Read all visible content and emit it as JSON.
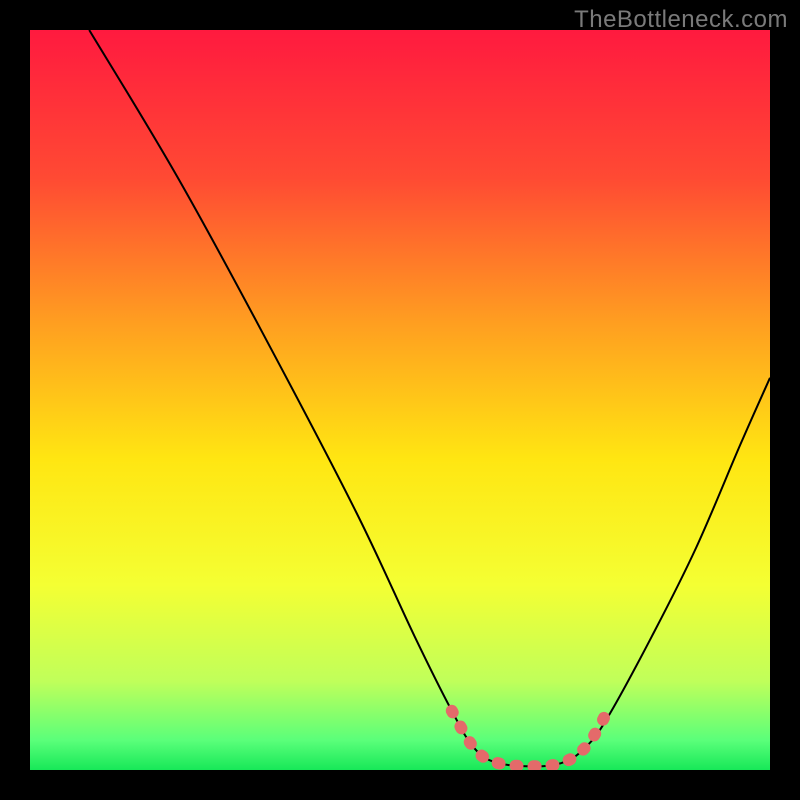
{
  "watermark": "TheBottleneck.com",
  "chart_data": {
    "type": "line",
    "title": "",
    "xlabel": "",
    "ylabel": "",
    "xlim": [
      0,
      100
    ],
    "ylim": [
      0,
      100
    ],
    "gradient_stops": [
      {
        "offset": 0.0,
        "color": "#ff1a3f"
      },
      {
        "offset": 0.2,
        "color": "#ff4a33"
      },
      {
        "offset": 0.4,
        "color": "#ffa020"
      },
      {
        "offset": 0.58,
        "color": "#ffe612"
      },
      {
        "offset": 0.75,
        "color": "#f4ff33"
      },
      {
        "offset": 0.88,
        "color": "#c0ff5a"
      },
      {
        "offset": 0.96,
        "color": "#5aff7a"
      },
      {
        "offset": 1.0,
        "color": "#17e858"
      }
    ],
    "series": [
      {
        "name": "bottleneck-curve",
        "stroke": "#000000",
        "stroke_width": 2,
        "points": [
          {
            "x": 8,
            "y": 100
          },
          {
            "x": 20,
            "y": 80
          },
          {
            "x": 32,
            "y": 58
          },
          {
            "x": 44,
            "y": 35
          },
          {
            "x": 52,
            "y": 18
          },
          {
            "x": 57,
            "y": 8
          },
          {
            "x": 60,
            "y": 3
          },
          {
            "x": 63,
            "y": 1
          },
          {
            "x": 68,
            "y": 0.5
          },
          {
            "x": 72,
            "y": 1
          },
          {
            "x": 75,
            "y": 3
          },
          {
            "x": 78,
            "y": 7
          },
          {
            "x": 84,
            "y": 18
          },
          {
            "x": 90,
            "y": 30
          },
          {
            "x": 96,
            "y": 44
          },
          {
            "x": 100,
            "y": 53
          }
        ]
      },
      {
        "name": "bottom-highlight",
        "stroke": "#e46a6a",
        "stroke_width": 12,
        "dash": "2 16",
        "linecap": "round",
        "points": [
          {
            "x": 57,
            "y": 8
          },
          {
            "x": 60,
            "y": 3
          },
          {
            "x": 63,
            "y": 1
          },
          {
            "x": 68,
            "y": 0.5
          },
          {
            "x": 72,
            "y": 1
          },
          {
            "x": 75,
            "y": 3
          },
          {
            "x": 77,
            "y": 6
          },
          {
            "x": 78,
            "y": 8
          }
        ]
      }
    ]
  }
}
